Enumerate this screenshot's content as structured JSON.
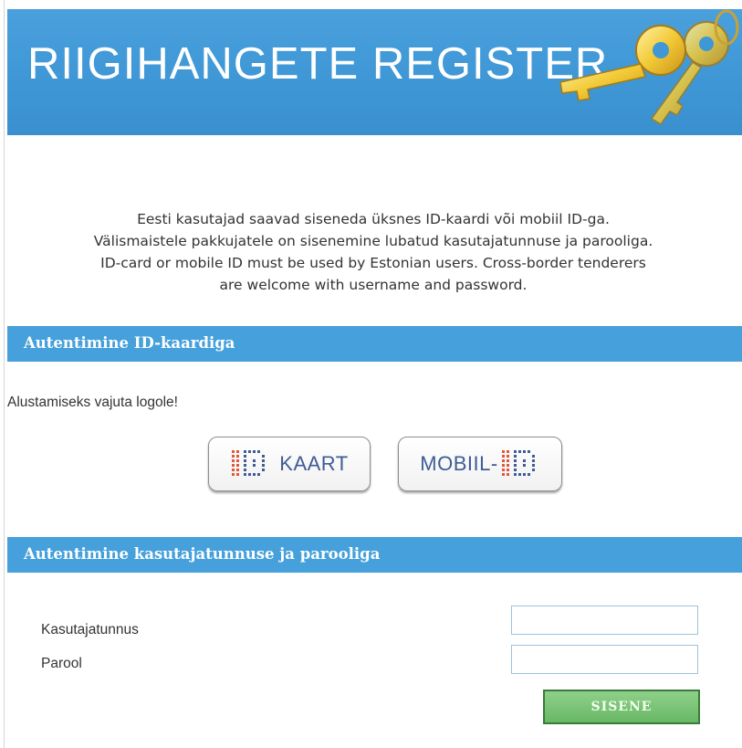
{
  "header": {
    "title": "RIIGIHANGETE REGISTER",
    "logo_icon": "keys-icon"
  },
  "intro": {
    "lines": [
      "Eesti kasutajad saavad siseneda üksnes ID-kaardi või mobiil ID-ga.",
      "Välismaistele pakkujatele on sisenemine lubatud kasutajatunnuse ja parooliga.",
      "ID-card or mobile ID must be used by Estonian users. Cross-border tenderers",
      "are welcome with username and password."
    ]
  },
  "id_section": {
    "title": "Autentimine ID-kaardiga",
    "hint": "Alustamiseks vajuta logole!",
    "id_card_button": {
      "label": "KAART",
      "icon": "id-logo-icon"
    },
    "mobile_id_button": {
      "label": "MOBIIL-",
      "icon": "id-logo-icon"
    }
  },
  "password_section": {
    "title": "Autentimine kasutajatunnuse ja parooliga",
    "username_label": "Kasutajatunnus",
    "username_value": "",
    "password_label": "Parool",
    "password_value": "",
    "submit_label": "SISENE"
  },
  "colors": {
    "header_blue": "#3f97d6",
    "section_blue": "#45a0db",
    "submit_green": "#68b865",
    "id_red": "#e2573a",
    "id_blue": "#3f5c94"
  }
}
